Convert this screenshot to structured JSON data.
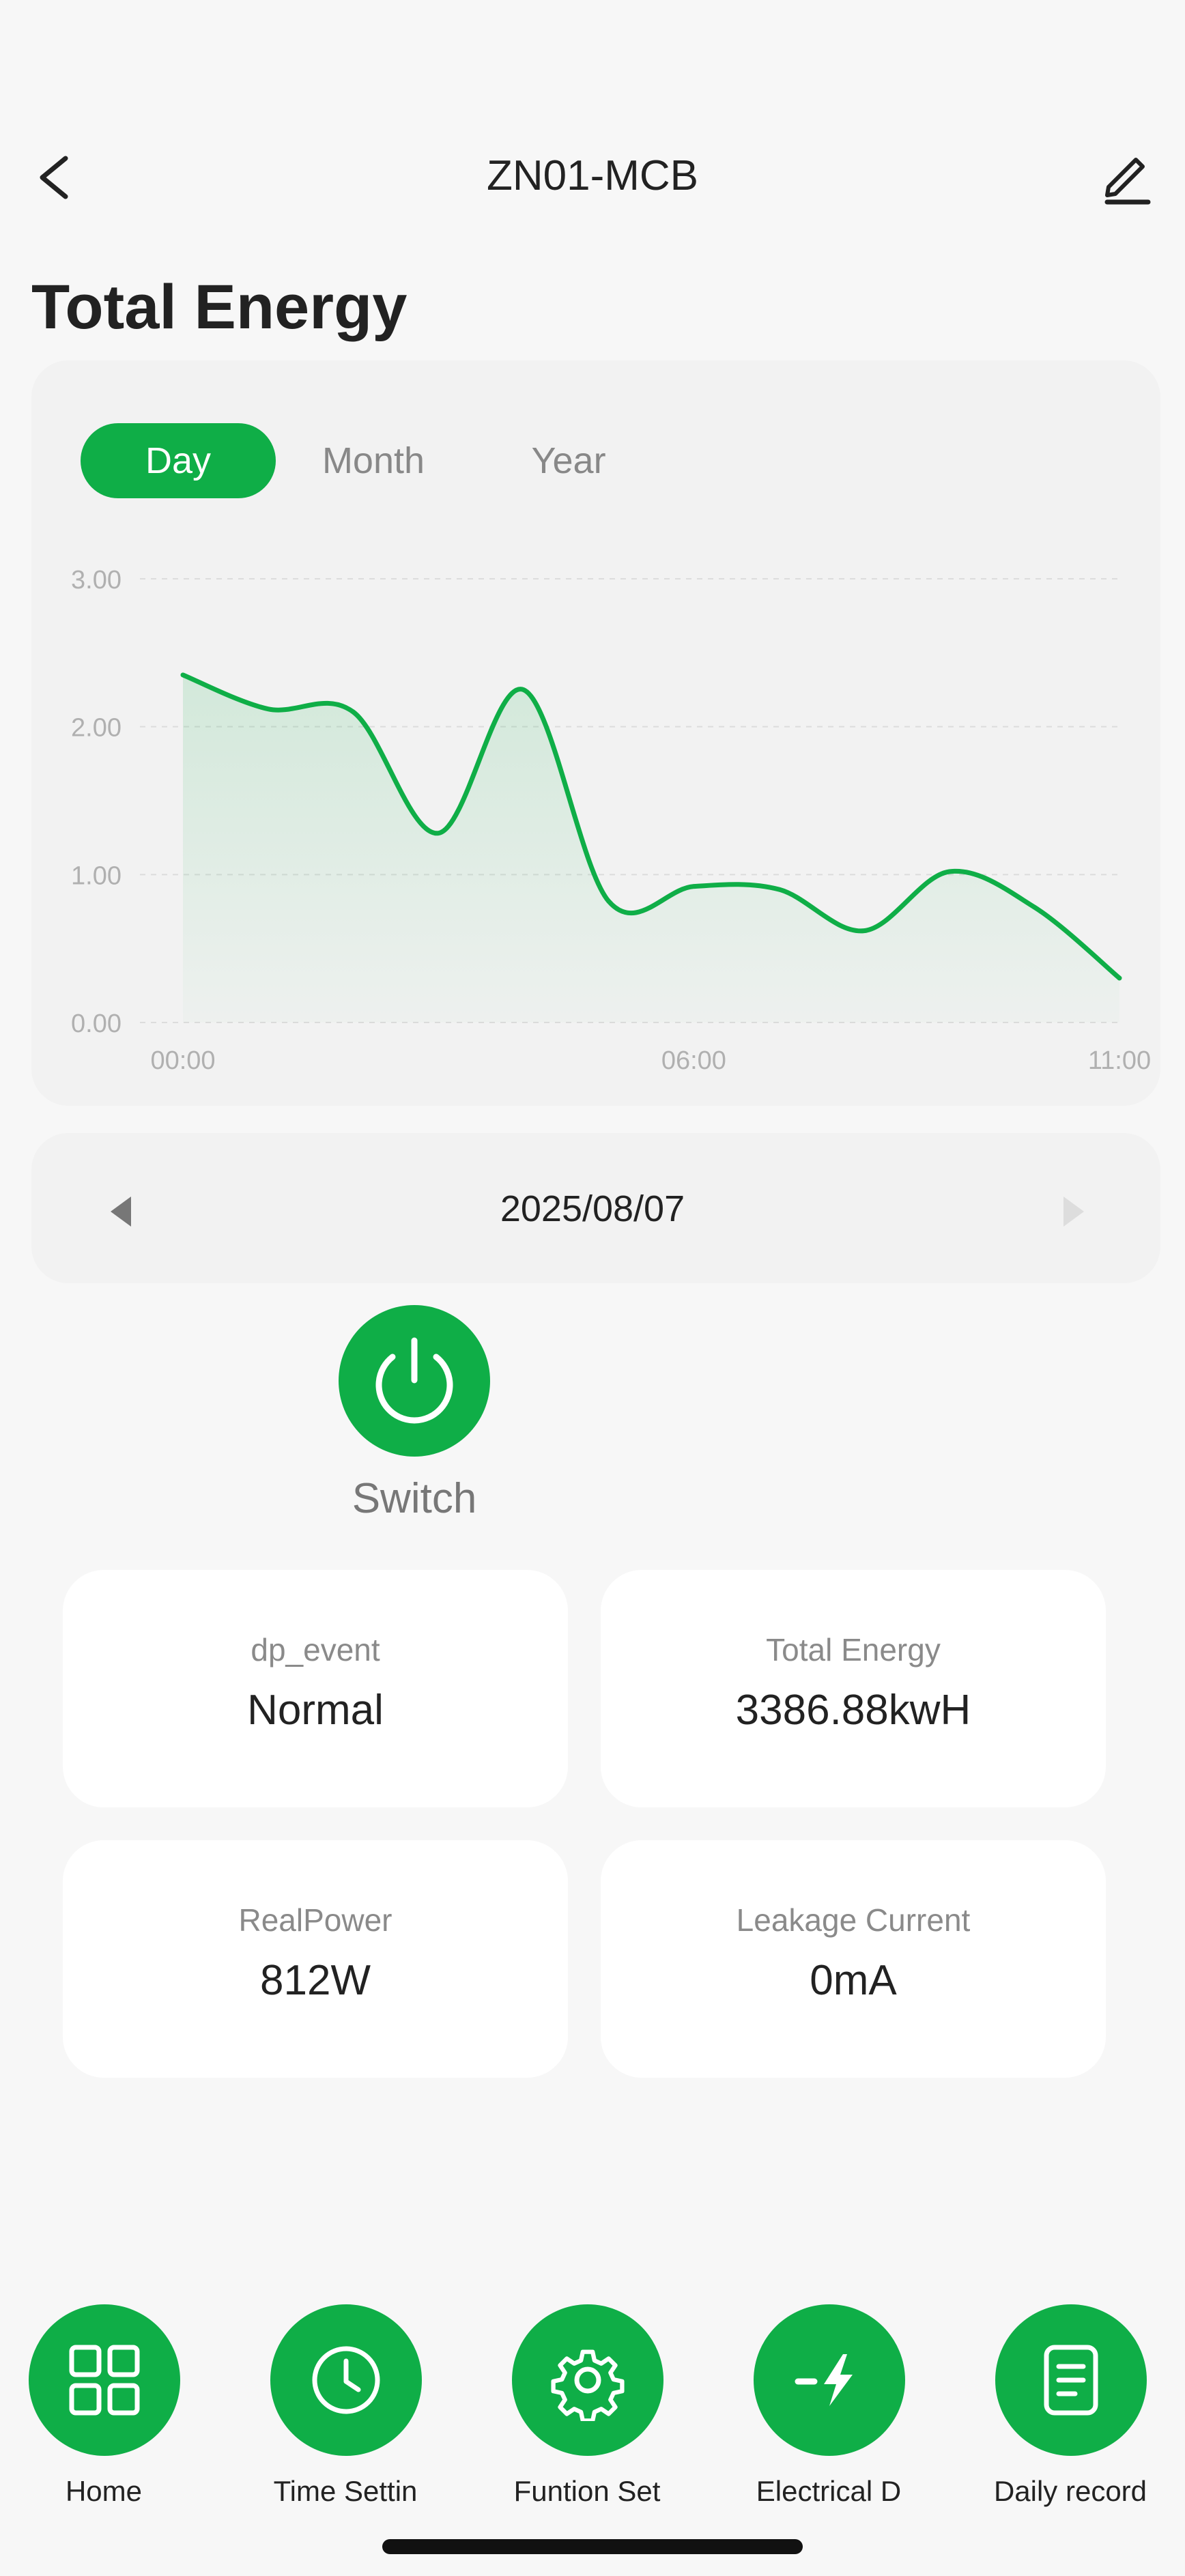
{
  "header": {
    "title": "ZN01-MCB",
    "back_icon": "chevron-left-icon",
    "edit_icon": "pencil-icon"
  },
  "section_title": "Total Energy",
  "tabs": [
    {
      "label": "Day",
      "active": true
    },
    {
      "label": "Month",
      "active": false
    },
    {
      "label": "Year",
      "active": false
    }
  ],
  "chart_data": {
    "type": "area",
    "x_tick_labels": [
      "00:00",
      "06:00",
      "11:00"
    ],
    "y_tick_labels": [
      "3.00",
      "2.00",
      "1.00",
      "0.00"
    ],
    "ylim": [
      0,
      3
    ],
    "xlim": [
      0,
      11
    ],
    "grid": true,
    "line_color": "#0fae47",
    "series": [
      {
        "x": [
          0,
          1,
          2,
          3,
          4,
          5,
          6,
          7,
          8,
          9,
          10,
          11
        ],
        "values": [
          2.35,
          2.12,
          2.1,
          1.28,
          2.25,
          0.82,
          0.92,
          0.9,
          0.62,
          1.02,
          0.78,
          0.3
        ]
      }
    ]
  },
  "date_nav": {
    "date": "2025/08/07",
    "prev_icon": "triangle-left-icon",
    "next_icon": "triangle-right-icon"
  },
  "switch": {
    "label": "Switch",
    "icon": "power-icon"
  },
  "info_cards": [
    {
      "label": "dp_event",
      "value": "Normal"
    },
    {
      "label": "Total Energy",
      "value": "3386.88kwH"
    },
    {
      "label": "RealPower",
      "value": "812W"
    },
    {
      "label": "Leakage Current",
      "value": "0mA"
    }
  ],
  "bottom_nav": [
    {
      "label": "Home",
      "icon": "grid-icon"
    },
    {
      "label": "Time Settin",
      "icon": "clock-icon"
    },
    {
      "label": "Funtion Set",
      "icon": "gear-icon"
    },
    {
      "label": "Electrical D",
      "icon": "lightning-icon"
    },
    {
      "label": "Daily record",
      "icon": "document-icon"
    }
  ],
  "colors": {
    "accent": "#0fae47",
    "background": "#f7f7f7",
    "card": "#ffffff"
  }
}
